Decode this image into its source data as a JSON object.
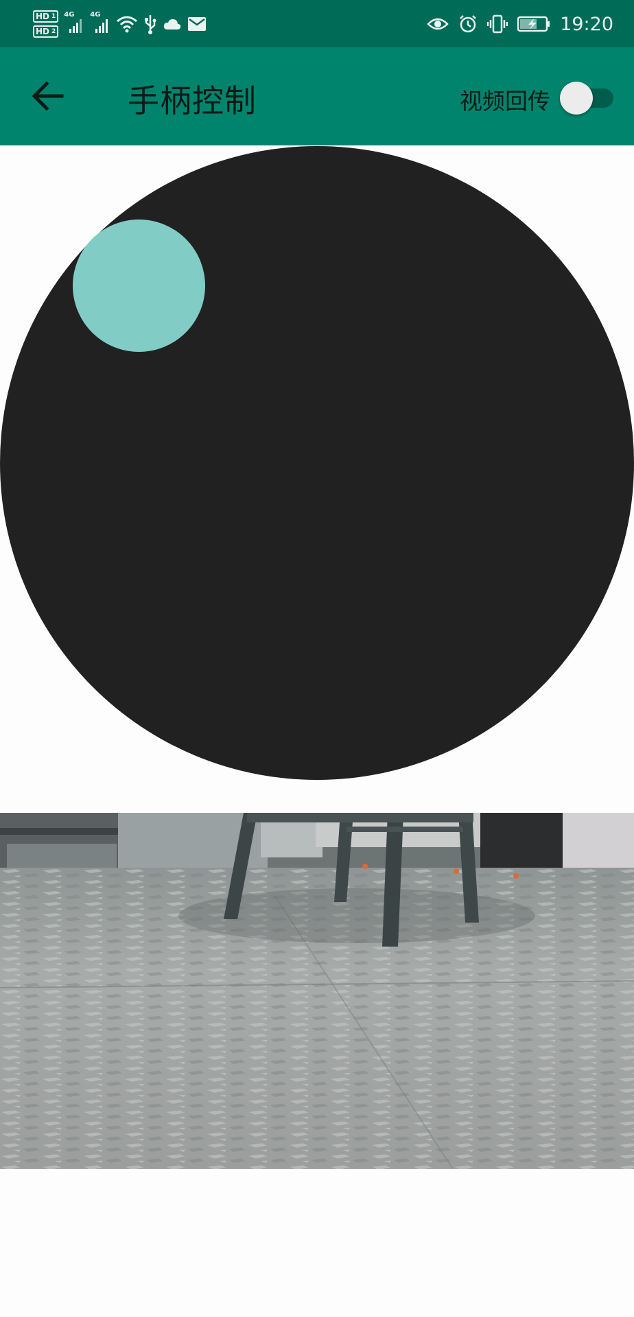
{
  "status_bar": {
    "sim1_label": "HD",
    "sim1_index": "1",
    "sim2_label": "HD",
    "sim2_index": "2",
    "network_type_1": "4G",
    "network_type_2": "4G",
    "icons": [
      "signal-icon",
      "signal-icon",
      "wifi-icon",
      "usb-icon",
      "cloud-icon",
      "mail-icon",
      "eye-icon",
      "alarm-icon",
      "vibrate-icon",
      "battery-charging-icon"
    ],
    "time": "19:20"
  },
  "app_bar": {
    "title": "手柄控制",
    "toggle_label": "视频回传",
    "toggle_on": false,
    "colors": {
      "status_bar": "#006c58",
      "app_bar": "#00846d"
    }
  },
  "joystick": {
    "base_color": "#212121",
    "knob_color": "#81cdc5"
  },
  "video_feed": {
    "description_icon": "camera-feed-image"
  }
}
